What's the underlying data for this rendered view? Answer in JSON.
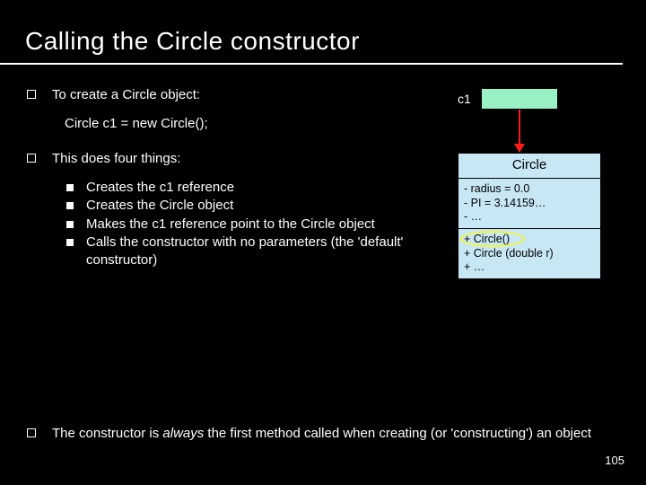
{
  "title": "Calling the Circle constructor",
  "bullets": {
    "b1": "To create a Circle object:",
    "code": "Circle c1 = new Circle();",
    "b2": "This does four things:",
    "b2_items": {
      "i1": "Creates the c1 reference",
      "i2": "Creates the Circle object",
      "i3": "Makes the c1 reference point to the Circle object",
      "i4": "Calls the constructor with no parameters (the 'default' constructor)"
    },
    "b3_pre": "The constructor is ",
    "b3_em": "always",
    "b3_post": " the first method called when creating (or 'constructing') an object"
  },
  "diagram": {
    "ref_label": "c1",
    "uml": {
      "class_name": "Circle",
      "attrs": {
        "a1": "- radius = 0.0",
        "a2": "- PI = 3.14159…",
        "a3": "- …"
      },
      "methods": {
        "m1": "+ Circle()",
        "m2": "+ Circle (double r)",
        "m3": "+ …"
      }
    }
  },
  "slide_number": "105"
}
